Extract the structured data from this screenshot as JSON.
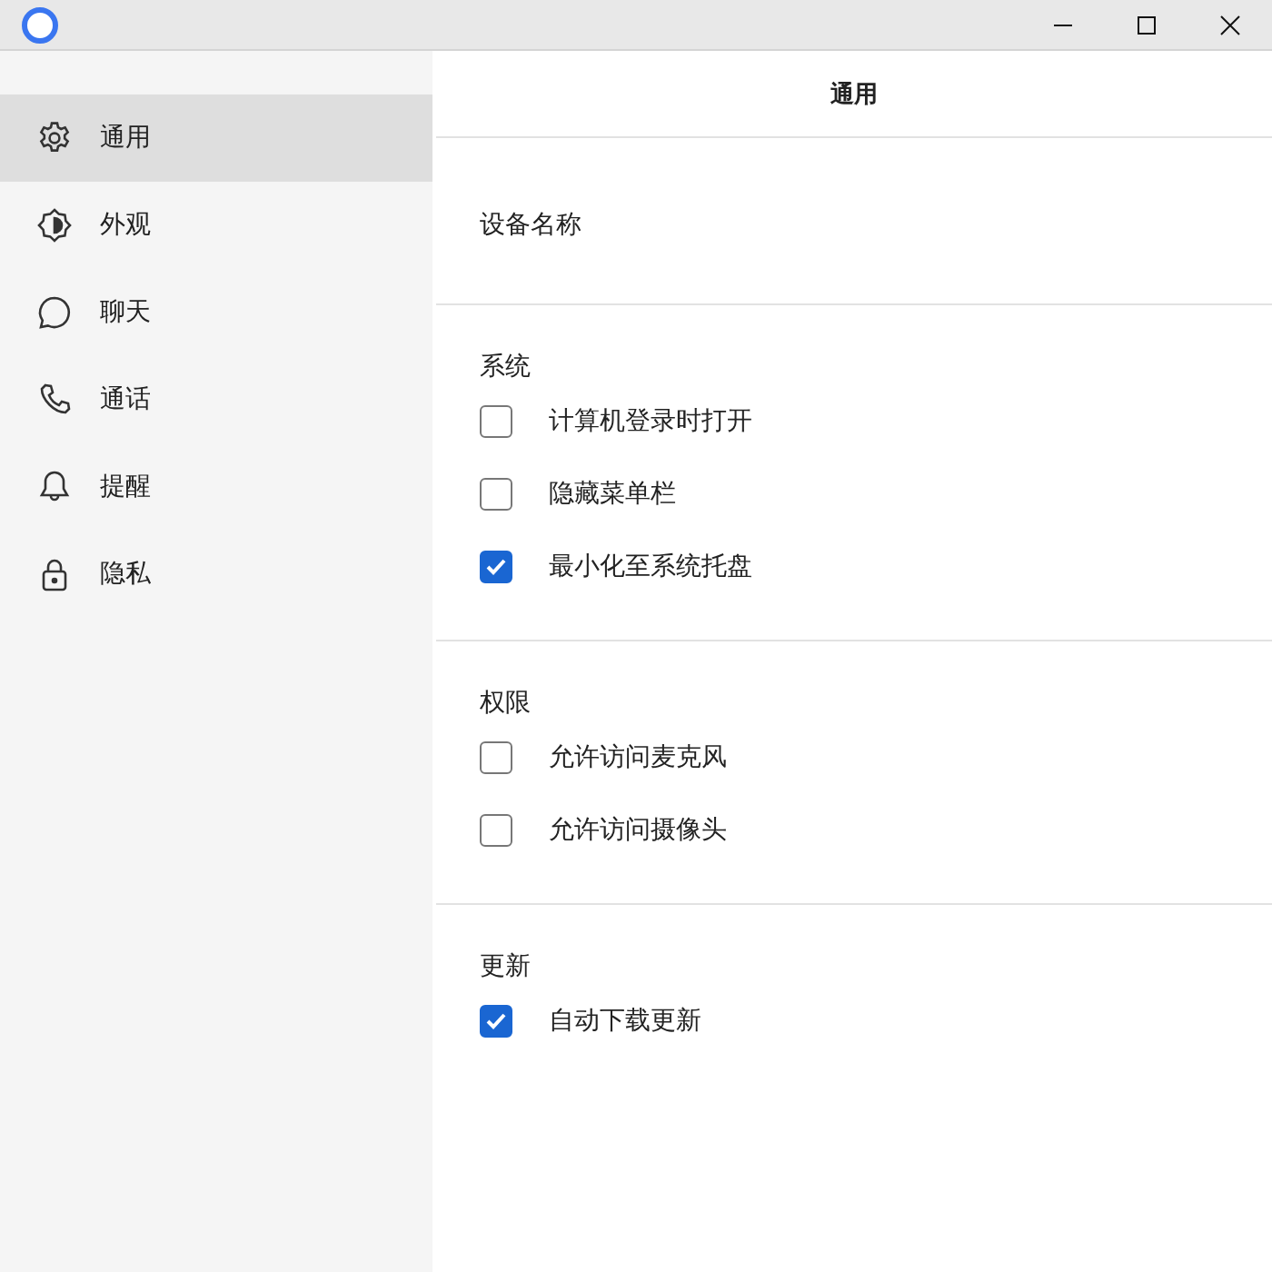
{
  "sidebar": {
    "items": [
      {
        "label": "通用",
        "selected": true
      },
      {
        "label": "外观",
        "selected": false
      },
      {
        "label": "聊天",
        "selected": false
      },
      {
        "label": "通话",
        "selected": false
      },
      {
        "label": "提醒",
        "selected": false
      },
      {
        "label": "隐私",
        "selected": false
      }
    ]
  },
  "content": {
    "title": "通用",
    "device_name": {
      "label": "设备名称"
    },
    "sections": [
      {
        "title": "系统",
        "options": [
          {
            "label": "计算机登录时打开",
            "checked": false
          },
          {
            "label": "隐藏菜单栏",
            "checked": false
          },
          {
            "label": "最小化至系统托盘",
            "checked": true
          }
        ]
      },
      {
        "title": "权限",
        "options": [
          {
            "label": "允许访问麦克风",
            "checked": false
          },
          {
            "label": "允许访问摄像头",
            "checked": false
          }
        ]
      },
      {
        "title": "更新",
        "options": [
          {
            "label": "自动下载更新",
            "checked": true
          }
        ]
      }
    ]
  }
}
